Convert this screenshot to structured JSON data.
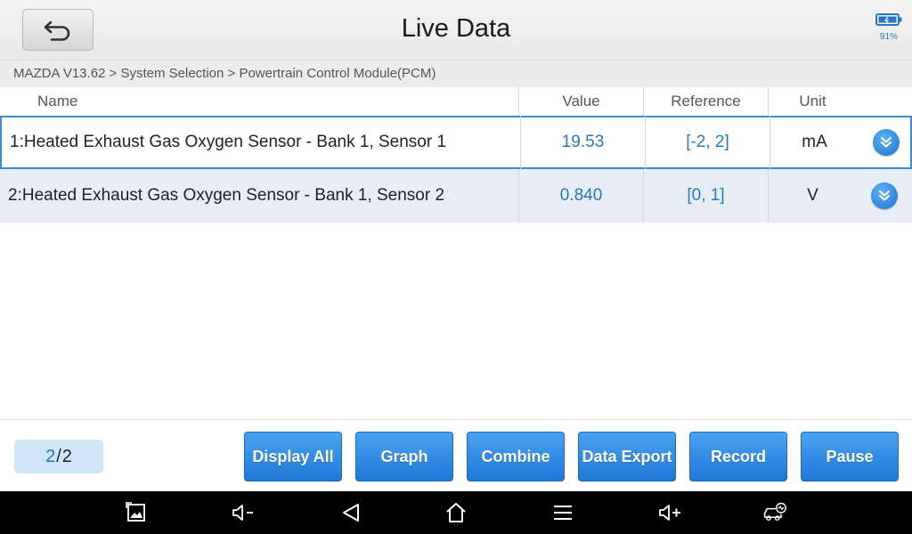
{
  "header": {
    "title": "Live Data",
    "battery_label": "91%"
  },
  "breadcrumb": "MAZDA  V13.62 > System Selection  > Powertrain Control Module(PCM)",
  "table": {
    "columns": [
      "Name",
      "Value",
      "Reference",
      "Unit"
    ],
    "rows": [
      {
        "name": "1:Heated Exhaust Gas Oxygen Sensor - Bank 1, Sensor 1",
        "value": "19.53",
        "reference": "[-2, 2]",
        "unit": "mA"
      },
      {
        "name": "2:Heated Exhaust Gas Oxygen Sensor - Bank 1, Sensor 2",
        "value": "0.840",
        "reference": "[0, 1]",
        "unit": "V"
      }
    ]
  },
  "pager": {
    "current": "2",
    "separator": "/",
    "total": "2"
  },
  "toolbar": {
    "display_all": "Display All",
    "graph": "Graph",
    "combine": "Combine",
    "data_export": "Data Export",
    "record": "Record",
    "pause": "Pause"
  },
  "icons": {
    "back": "back-arrow-icon",
    "battery": "battery-icon",
    "expand": "chevron-double-down-icon",
    "nav": [
      "screenshot-icon",
      "volume-down-icon",
      "back-triangle-icon",
      "home-icon",
      "menu-icon",
      "volume-up-icon",
      "car-diagnostic-icon"
    ]
  },
  "colors": {
    "accent": "#2778c2",
    "button": "#1f78d8",
    "selected_border": "#3a8ad8"
  }
}
